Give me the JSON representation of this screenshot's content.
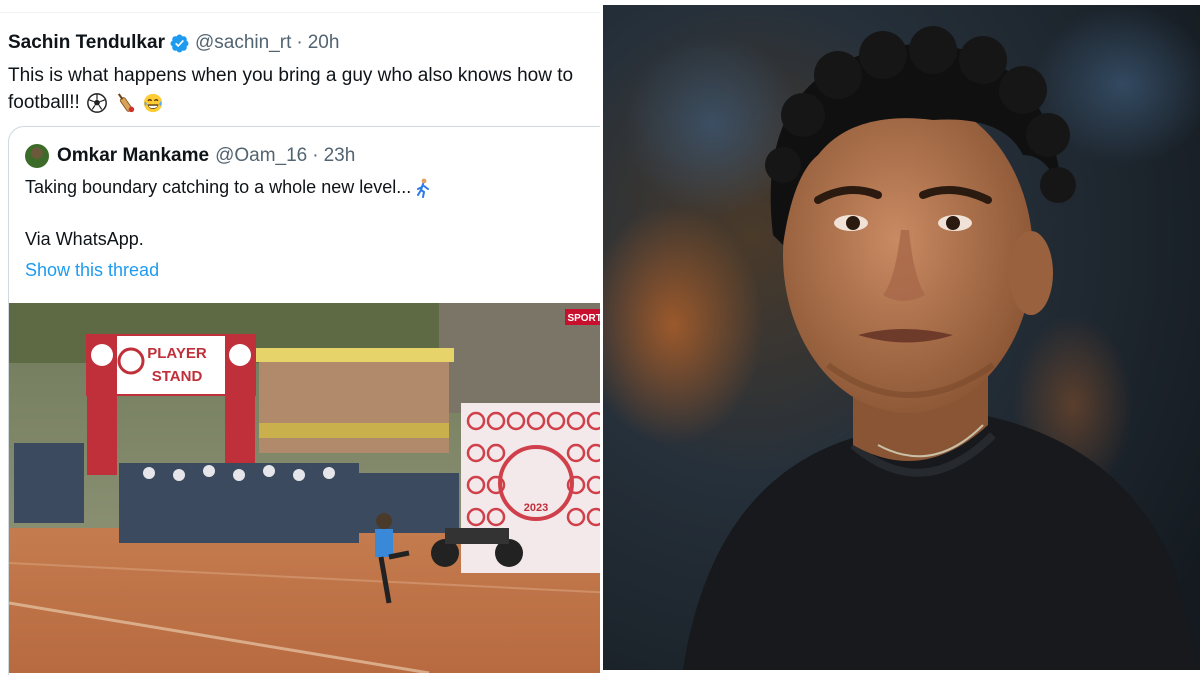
{
  "tweet": {
    "author_name": "Sachin Tendulkar",
    "handle": "@sachin_rt",
    "separator": "·",
    "time": "20h",
    "text_line1": "This is what happens when you bring a guy who also knows how to",
    "text_line2": "football!!",
    "emojis": [
      "soccer-ball-icon",
      "cricket-bat-icon",
      "tears-of-joy-icon"
    ],
    "verified_color": "#1d9bf0"
  },
  "quoted_tweet": {
    "author_name": "Omkar Mankame",
    "handle": "@Oam_16",
    "separator": "·",
    "time": "23h",
    "text_line1": "Taking boundary catching to a whole new level...",
    "text_line2": "Via WhatsApp.",
    "show_thread_label": "Show this thread",
    "link_color": "#1d9bf0"
  },
  "video_scene": {
    "banner_left_line1": "PLAYER",
    "banner_left_line2": "STAND",
    "sponsor_year": "2023",
    "watermark": "SPORTS"
  }
}
